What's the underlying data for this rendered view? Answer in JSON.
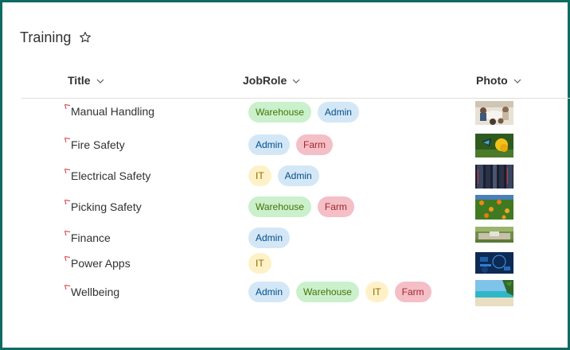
{
  "list": {
    "title": "Training"
  },
  "columns": {
    "title": "Title",
    "jobrole": "JobRole",
    "photo": "Photo"
  },
  "role_labels": {
    "warehouse": "Warehouse",
    "admin": "Admin",
    "farm": "Farm",
    "it": "IT"
  },
  "rows": [
    {
      "title": "Manual Handling",
      "roles": [
        "Warehouse",
        "Admin"
      ],
      "photo": "people-meeting-photo"
    },
    {
      "title": "Fire Safety",
      "roles": [
        "Admin",
        "Farm"
      ],
      "photo": "butterfly-flower-photo"
    },
    {
      "title": "Electrical Safety",
      "roles": [
        "IT",
        "Admin"
      ],
      "photo": "server-racks-photo"
    },
    {
      "title": "Picking Safety",
      "roles": [
        "Warehouse",
        "Farm"
      ],
      "photo": "orange-tree-photo"
    },
    {
      "title": "Finance",
      "roles": [
        "Admin"
      ],
      "photo": "desk-laptop-photo"
    },
    {
      "title": "Power Apps",
      "roles": [
        "IT"
      ],
      "photo": "tech-screen-photo"
    },
    {
      "title": "Wellbeing",
      "roles": [
        "Admin",
        "Warehouse",
        "IT",
        "Farm"
      ],
      "photo": "beach-photo"
    }
  ],
  "colors": {
    "frame": "#0f6b62",
    "new_indicator": "#d13438",
    "divider": "#e1dfdd"
  }
}
